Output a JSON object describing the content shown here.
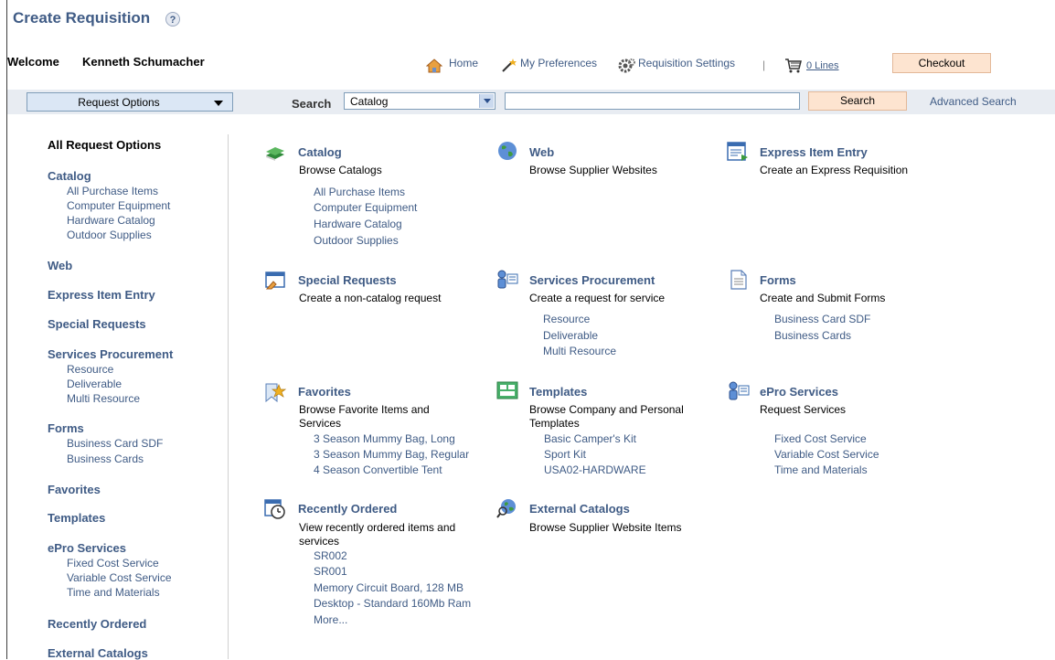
{
  "header": {
    "title": "Create Requisition",
    "help_icon": "?",
    "welcome": "Welcome",
    "user": "Kenneth Schumacher"
  },
  "nav": {
    "home": "Home",
    "preferences": "My Preferences",
    "settings": "Requisition Settings",
    "separator": "|",
    "lines": "0 Lines",
    "checkout": "Checkout"
  },
  "searchbar": {
    "request_options": "Request Options",
    "search_label": "Search",
    "select_value": "Catalog",
    "input_value": "",
    "search_button": "Search",
    "advanced": "Advanced Search"
  },
  "sidebar": {
    "all": "All Request Options",
    "catalog": "Catalog",
    "catalog_items": [
      "All Purchase Items",
      "Computer Equipment",
      "Hardware Catalog",
      "Outdoor Supplies"
    ],
    "web": "Web",
    "express": "Express Item Entry",
    "special": "Special Requests",
    "services": "Services Procurement",
    "services_items": [
      "Resource",
      "Deliverable",
      "Multi Resource"
    ],
    "forms": "Forms",
    "forms_items": [
      "Business Card SDF",
      "Business Cards"
    ],
    "favorites": "Favorites",
    "templates": "Templates",
    "epro": "ePro Services",
    "epro_items": [
      "Fixed Cost Service",
      "Variable Cost Service",
      "Time and Materials"
    ],
    "recent": "Recently Ordered",
    "external": "External Catalogs"
  },
  "tiles": {
    "catalog": {
      "title": "Catalog",
      "desc": "Browse Catalogs",
      "links": [
        "All Purchase Items",
        "Computer Equipment",
        "Hardware Catalog",
        "Outdoor Supplies"
      ]
    },
    "web": {
      "title": "Web",
      "desc": "Browse Supplier Websites"
    },
    "express": {
      "title": "Express Item Entry",
      "desc": "Create an Express Requisition"
    },
    "special": {
      "title": "Special Requests",
      "desc": "Create a non-catalog request"
    },
    "services": {
      "title": "Services Procurement",
      "desc": "Create a request for service",
      "links": [
        "Resource",
        "Deliverable",
        "Multi Resource"
      ]
    },
    "forms": {
      "title": "Forms",
      "desc": "Create and Submit Forms",
      "links": [
        "Business Card SDF",
        "Business Cards"
      ]
    },
    "favorites": {
      "title": "Favorites",
      "desc_1": "Browse Favorite Items and",
      "desc_2": "Services",
      "links": [
        "3 Season Mummy Bag, Long",
        "3 Season Mummy Bag, Regular",
        "4 Season Convertible Tent"
      ]
    },
    "templates": {
      "title": "Templates",
      "desc_1": "Browse Company and Personal",
      "desc_2": "Templates",
      "links": [
        "Basic Camper's Kit",
        "Sport Kit",
        "USA02-HARDWARE"
      ]
    },
    "epro": {
      "title": "ePro Services",
      "desc": "Request Services",
      "links": [
        "Fixed Cost Service",
        "Variable Cost Service",
        "Time and Materials"
      ]
    },
    "recent": {
      "title": "Recently Ordered",
      "desc_1": "View recently ordered items and",
      "desc_2": "services",
      "links": [
        "SR002",
        "SR001",
        "Memory Circuit Board, 128 MB",
        "Desktop - Standard 160Mb Ram",
        "More..."
      ]
    },
    "external": {
      "title": "External Catalogs",
      "desc": "Browse Supplier Website Items"
    }
  }
}
